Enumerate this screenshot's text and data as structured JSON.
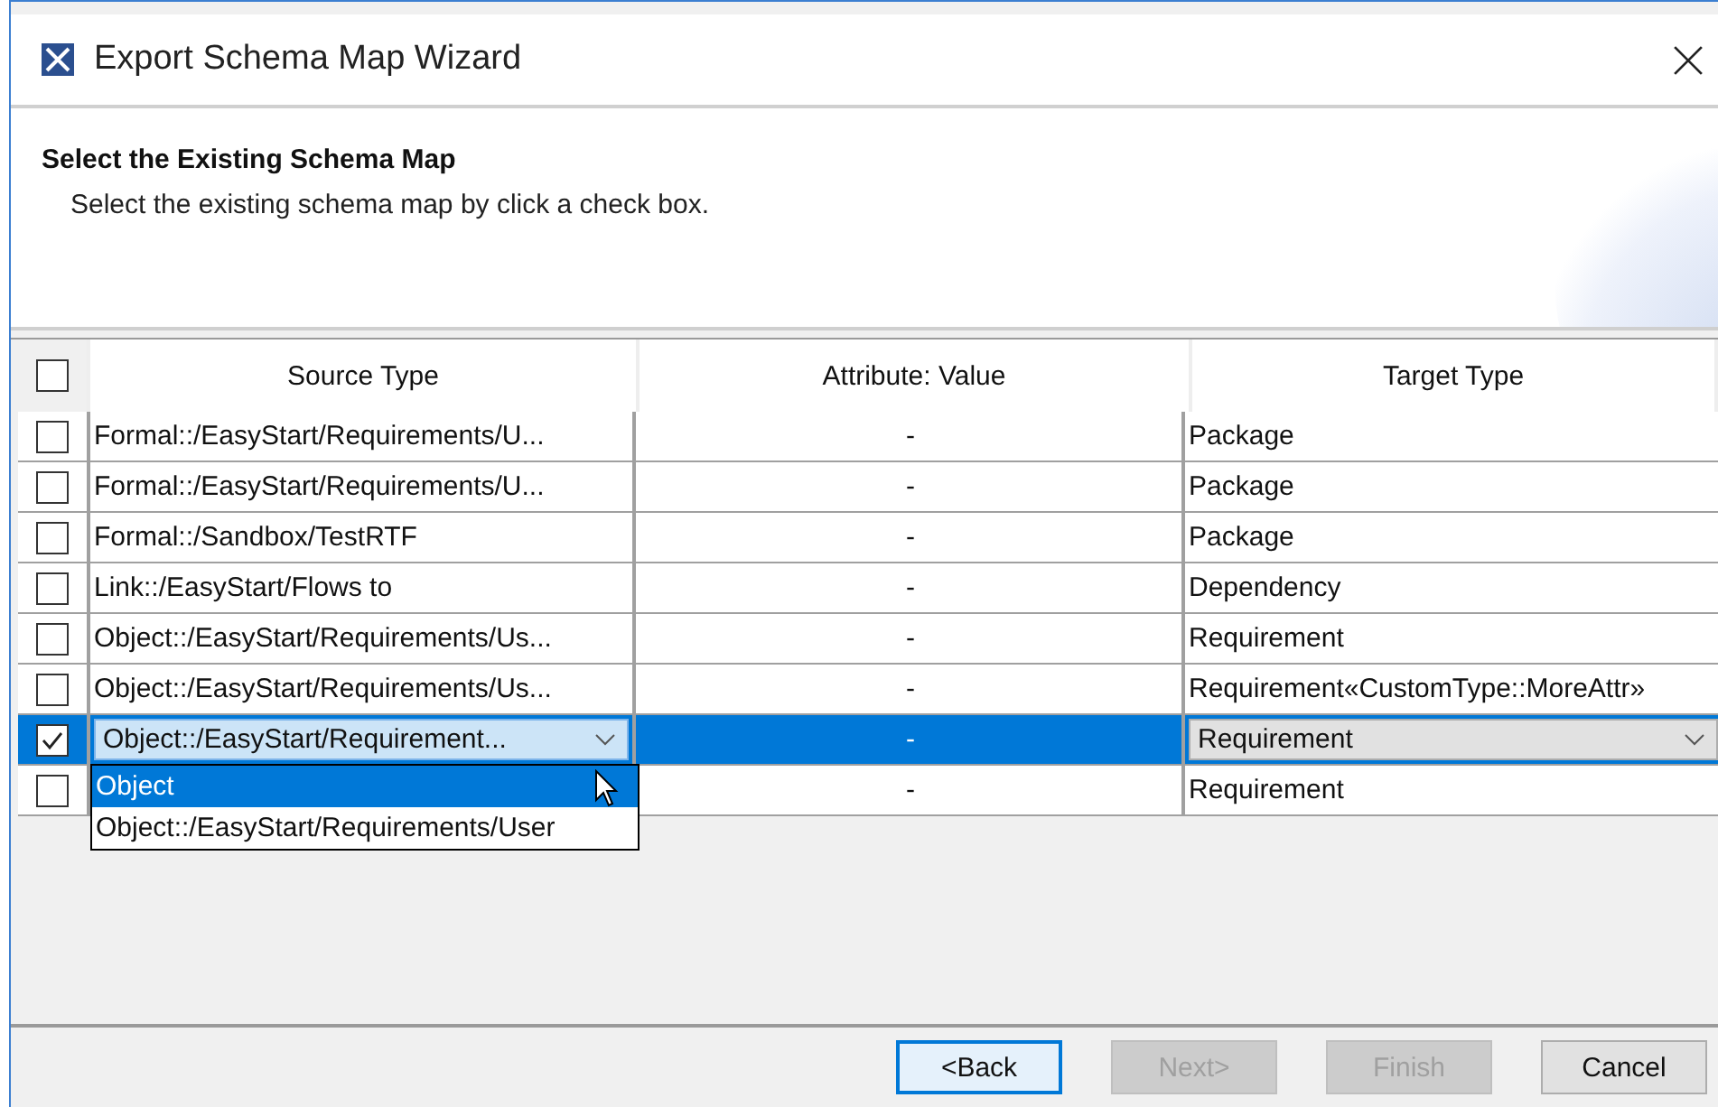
{
  "window": {
    "title": "Export Schema Map Wizard"
  },
  "header": {
    "title": "Select the Existing Schema Map",
    "description": "Select the existing schema map by click a check box."
  },
  "table": {
    "select_all": {
      "checked": false
    },
    "columns": [
      "Source Type",
      "Attribute: Value",
      "Target Type"
    ],
    "rows": [
      {
        "checked": false,
        "selected": false,
        "source": "Formal::/EasyStart/Requirements/U...",
        "attribute": "-",
        "target": "Package"
      },
      {
        "checked": false,
        "selected": false,
        "source": "Formal::/EasyStart/Requirements/U...",
        "attribute": "-",
        "target": "Package"
      },
      {
        "checked": false,
        "selected": false,
        "source": "Formal::/Sandbox/TestRTF",
        "attribute": "-",
        "target": "Package"
      },
      {
        "checked": false,
        "selected": false,
        "source": "Link::/EasyStart/Flows to",
        "attribute": "-",
        "target": "Dependency"
      },
      {
        "checked": false,
        "selected": false,
        "source": "Object::/EasyStart/Requirements/Us...",
        "attribute": "-",
        "target": "Requirement"
      },
      {
        "checked": false,
        "selected": false,
        "source": "Object::/EasyStart/Requirements/Us...",
        "attribute": "-",
        "target": "Requirement«CustomType::MoreAttr»"
      },
      {
        "checked": true,
        "selected": true,
        "source": "Object::/EasyStart/Requirement...",
        "attribute": "-",
        "target": "Requirement",
        "dropdown": [
          {
            "label": "Object",
            "selected": true
          },
          {
            "label": "Object::/EasyStart/Requirements/User",
            "selected": false
          }
        ]
      },
      {
        "checked": false,
        "selected": false,
        "attribute": "-",
        "target": "Requirement"
      }
    ]
  },
  "buttons": [
    {
      "label": "<Back",
      "disabled": false,
      "default": true
    },
    {
      "label": "Next>",
      "disabled": true,
      "default": false
    },
    {
      "label": "Finish",
      "disabled": true,
      "default": false
    },
    {
      "label": "Cancel",
      "disabled": false,
      "default": false
    }
  ]
}
